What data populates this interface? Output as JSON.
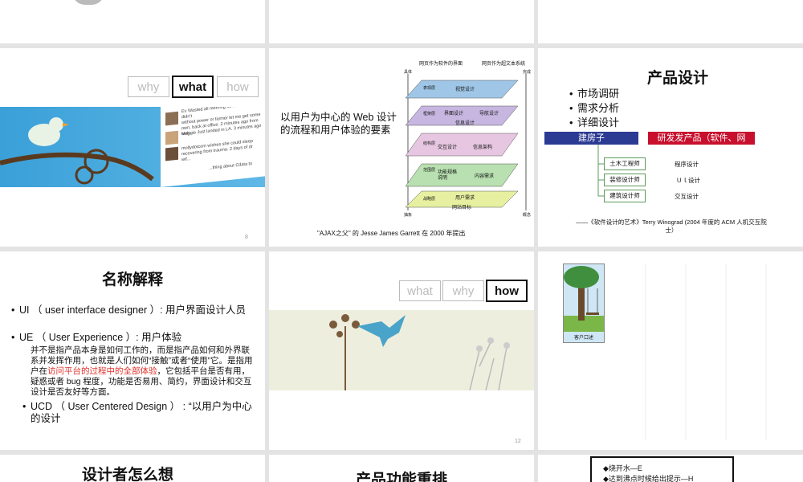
{
  "slide5": {
    "tabs": [
      "why",
      "what",
      "how"
    ],
    "tweets": [
      {
        "text": "Ev Wasted all morning for FORL who didn't\nwithout power or farmer let me get some\nown, back at office. 2 minutes ago from web"
      },
      {
        "text": "Maggie Just landed in LA. 3 minutes ago"
      },
      {
        "text": "mollydotcom wishes she could sleep\nrecovering from trauma. 2 days of dr\nwif..."
      },
      {
        "text": "...thing about Cdata to"
      }
    ],
    "page": "8"
  },
  "slide6": {
    "caption": "以用户为中心的 Web 设计\n的流程和用户体验的要素",
    "header_left": "网页作为软件的界面",
    "header_right": "网页作为超文本系统",
    "axis_top": "具体",
    "axis_bottom": "抽象",
    "axis_right_top": "完成",
    "axis_right_bottom": "概念",
    "layers": [
      {
        "left": "表现层",
        "center": "视觉设计"
      },
      {
        "left": "框架层",
        "center": "界面设计",
        "right": "导航设计",
        "sub": "信息设计"
      },
      {
        "left": "结构层",
        "center": "交互设计",
        "right": "信息架构"
      },
      {
        "left": "范围层",
        "center": "功能规格\n说明",
        "right": "内容需求"
      },
      {
        "left": "战略层",
        "center": "用户需求",
        "sub": "网站目标"
      }
    ],
    "footer": "\"AJAX之父\" 的 Jesse James Garrett 在 2000 年提出"
  },
  "slide7": {
    "title": "产品设计",
    "bullets": [
      "市场调研",
      "需求分析",
      "详细设计"
    ],
    "left_bar": "建房子",
    "right_bar": "研发发产品（软件、网",
    "roles_left": [
      "土木工程师",
      "装修设计师",
      "建筑设计师"
    ],
    "roles_right": [
      "程序设计",
      "Ｕｌ设计",
      "交互设计"
    ],
    "quote": "——《软件设计的艺术》Terry Winograd (2004 年度的 ACM 人机交互院\n士）"
  },
  "slide8": {
    "title": "名称解释",
    "items": [
      {
        "text": "UI （ user interface designer ）: 用户界面设计人员"
      },
      {
        "text": "UE （ User Experience ）: 用户体验"
      },
      {
        "text": "UCD （ User Centered Design ） : “以用户为中心的设计"
      }
    ],
    "ue_desc_a": "并不是指产品本身是如何工作的，而是指产品如何和外界联系并发挥作用，也就是人们如何“接触”或者“使用”它。是指用户在",
    "ue_desc_red": "访问平台的过程中的全部体验",
    "ue_desc_b": "，它包括平台是否有用，疑惑或者 bug 程度，功能是否易用、简约，界面设计和交互设计是否友好等方面。"
  },
  "slide9": {
    "tabs": [
      "what",
      "why",
      "how"
    ],
    "page": "12"
  },
  "slide10": {
    "label": "客户口述"
  },
  "slide11": {
    "title": "设计者怎么想"
  },
  "slide12": {
    "title": "产品功能重排"
  },
  "slide13": {
    "lines": [
      "烧开水—E",
      "达到沸点时候给出提示—H"
    ]
  },
  "colors": {
    "accent_blue": "#2b3a93",
    "accent_red": "#c8102e",
    "highlight_red": "#e0312b"
  }
}
